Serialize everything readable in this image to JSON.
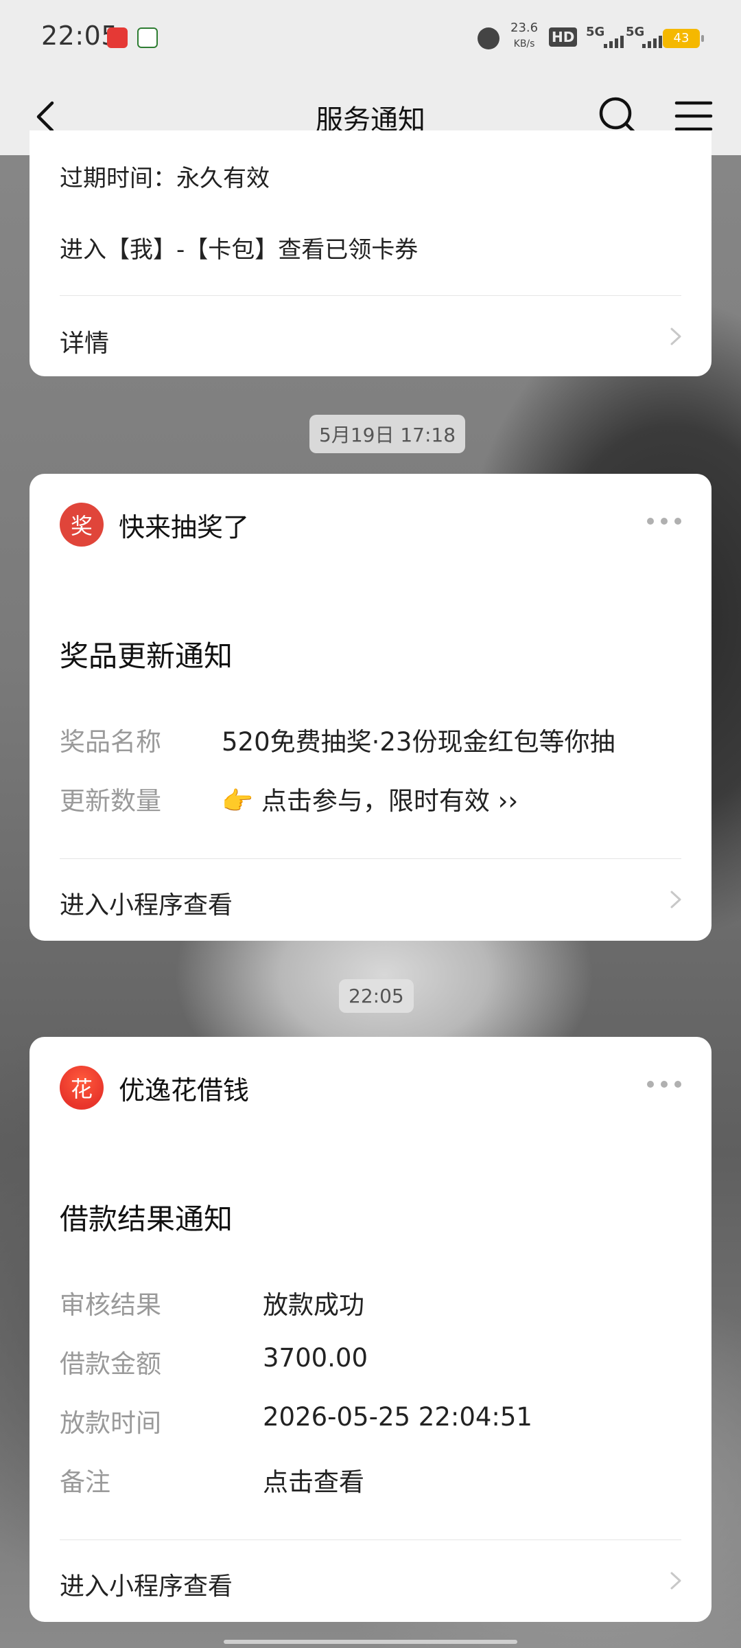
{
  "status_bar": {
    "time": "22:05",
    "speed_value": "23.6",
    "speed_unit": "KB/s",
    "network_hd": "HD",
    "signal1": "5G",
    "signal2": "5G",
    "battery": "43"
  },
  "nav": {
    "title": "服务通知",
    "back_icon": "back-arrow-icon",
    "search_icon": "search-icon",
    "menu_icon": "hamburger-menu-icon"
  },
  "card_top": {
    "line1": "过期时间：永久有效",
    "line2": "进入【我】-【卡包】查看已领卡券",
    "link": "详情"
  },
  "timestamp1": "5月19日 17:18",
  "card_lottery": {
    "avatar_text": "奖",
    "avatar_color": "#e0453a",
    "app_name": "快来抽奖了",
    "title": "奖品更新通知",
    "rows": [
      {
        "label": "奖品名称",
        "value": "520免费抽奖·23份现金红包等你抽"
      },
      {
        "label": "更新数量",
        "value": "👉 点击参与，限时有效 ››"
      }
    ],
    "link": "进入小程序查看"
  },
  "timestamp2": "22:05",
  "card_loan": {
    "avatar_text": "花",
    "avatar_color": "#e8352b",
    "app_name": "优逸花借钱",
    "title": "借款结果通知",
    "rows": [
      {
        "label": "审核结果",
        "value": "放款成功"
      },
      {
        "label": "借款金额",
        "value": "3700.00"
      },
      {
        "label": "放款时间",
        "value": "2026-05-25 22:04:51"
      },
      {
        "label": "备注",
        "value": "点击查看"
      }
    ],
    "link": "进入小程序查看"
  }
}
